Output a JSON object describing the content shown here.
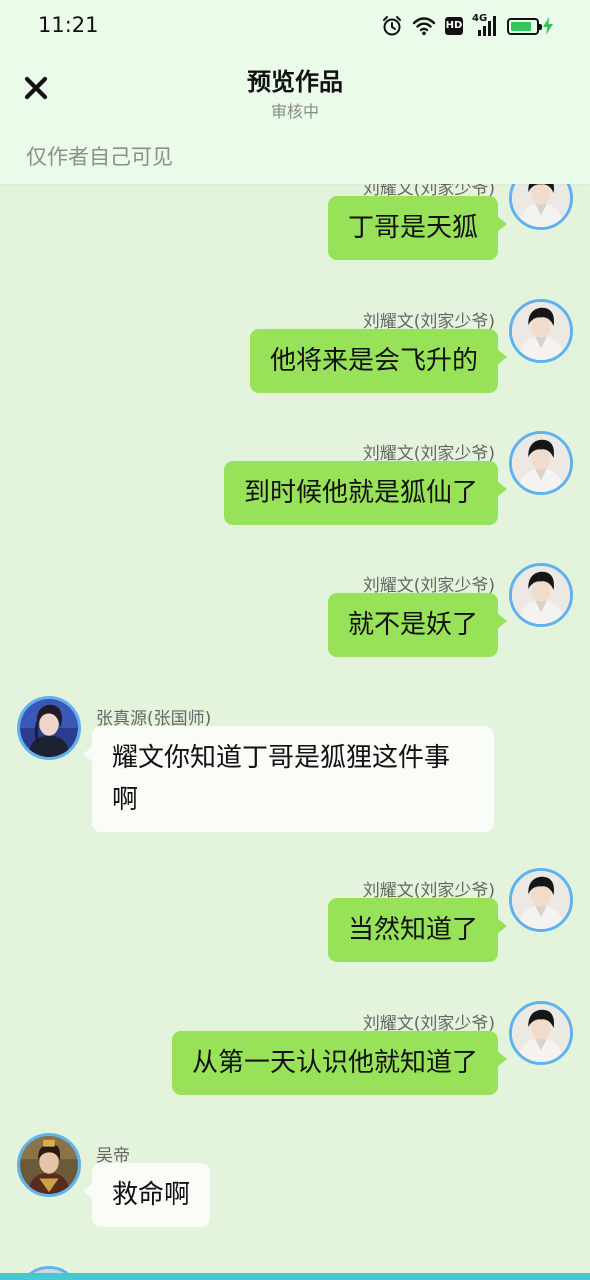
{
  "status_bar": {
    "time": "11:21",
    "hd_label": "HD",
    "network_label": "4G",
    "battery_level": 0.85,
    "icons": [
      "alarm-icon",
      "wifi-icon",
      "hd-icon",
      "signal-icon",
      "battery-icon",
      "charging-icon"
    ]
  },
  "header": {
    "close_icon": "close-icon",
    "title": "预览作品",
    "subtitle": "审核中",
    "visibility_note": "仅作者自己可见"
  },
  "messages": [
    {
      "side": "right",
      "name": "刘耀文(刘家少爷)",
      "text": "丁哥是天狐",
      "avatar": "liu-yaowen"
    },
    {
      "side": "right",
      "name": "刘耀文(刘家少爷)",
      "text": "他将来是会飞升的",
      "avatar": "liu-yaowen"
    },
    {
      "side": "right",
      "name": "刘耀文(刘家少爷)",
      "text": "到时候他就是狐仙了",
      "avatar": "liu-yaowen"
    },
    {
      "side": "right",
      "name": "刘耀文(刘家少爷)",
      "text": "就不是妖了",
      "avatar": "liu-yaowen"
    },
    {
      "side": "left",
      "name": "张真源(张国师)",
      "text": "耀文你知道丁哥是狐狸这件事啊",
      "avatar": "zhang-zhenyuan"
    },
    {
      "side": "right",
      "name": "刘耀文(刘家少爷)",
      "text": "当然知道了",
      "avatar": "liu-yaowen"
    },
    {
      "side": "right",
      "name": "刘耀文(刘家少爷)",
      "text": "从第一天认识他就知道了",
      "avatar": "liu-yaowen"
    },
    {
      "side": "left",
      "name": "吴帝",
      "text": "救命啊",
      "avatar": "wu-di"
    }
  ],
  "colors": {
    "background": "#e4f3dc",
    "header_background": "#eafbe9",
    "bubble_self": "#98e25a",
    "bubble_other": "#f9fcf7",
    "avatar_ring": "#5fb2f0",
    "battery_fill": "#35c65a"
  }
}
